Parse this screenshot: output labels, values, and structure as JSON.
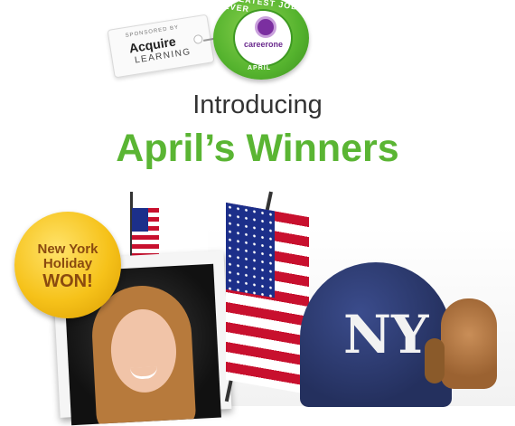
{
  "sponsor": {
    "small_text": "SPONSORED BY",
    "brand": "Acquire",
    "brand_sub": "LEARNING"
  },
  "badge": {
    "top_text": "GREATEST JOB EVER",
    "logo_text": "careerone",
    "bottom_text": "APRIL"
  },
  "heading": {
    "intro": "Introducing",
    "title": "April’s Winners"
  },
  "medal": {
    "line1": "New York",
    "line2": "Holiday",
    "line3": "WON!"
  },
  "cap": {
    "logo_text": "NY"
  },
  "colors": {
    "title_green": "#5ab533",
    "badge_green": "#55b32e",
    "medal_gold": "#f6c21a",
    "flag_blue": "#1c2f8a",
    "flag_red": "#c8102e"
  }
}
